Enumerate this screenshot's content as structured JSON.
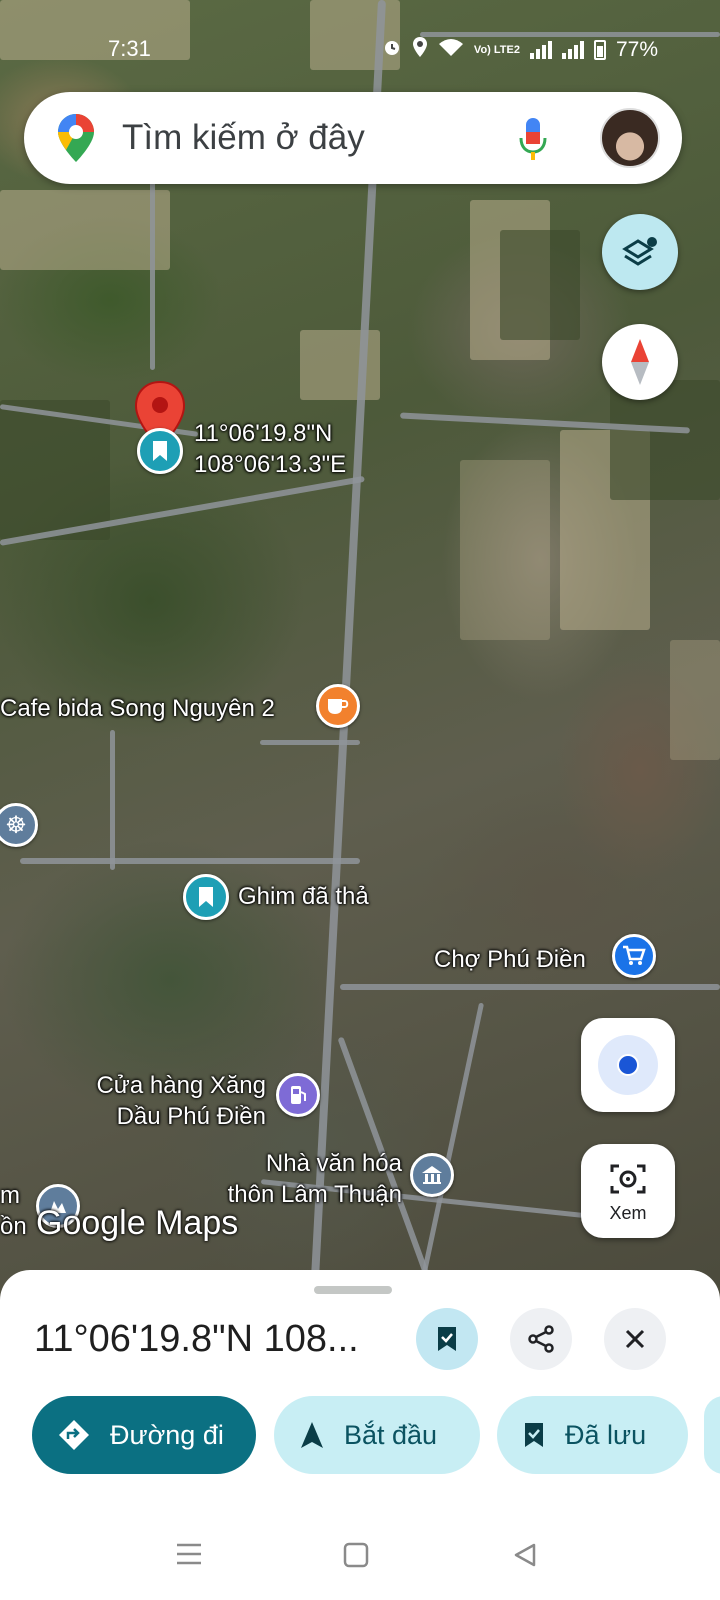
{
  "status_bar": {
    "time": "7:31",
    "volte_label": "Vo) LTE2",
    "battery": "77%"
  },
  "search": {
    "placeholder": "Tìm kiếm ở đây"
  },
  "map": {
    "dropped_pin_coords_line1": "11°06'19.8\"N",
    "dropped_pin_coords_line2": "108°06'13.3\"E",
    "places": {
      "cafe": "Cafe bida Song Nguyên 2",
      "dropped_pin": "Ghim đã thả",
      "market": "Chợ Phú Điền",
      "gas_line1": "Cửa hàng Xăng",
      "gas_line2": "Dầu Phú Điền",
      "hall_line1": "Nhà văn hóa",
      "hall_line2": "thôn Lâm Thuận",
      "partial_left_line1": "m",
      "partial_left_line2": "ồn"
    },
    "logo": "Google Maps"
  },
  "controls": {
    "lens_label": "Xem"
  },
  "sheet": {
    "title": "11°06'19.8\"N 108...",
    "directions_label": "Đường đi",
    "start_label": "Bắt đầu",
    "saved_label": "Đã lưu"
  },
  "colors": {
    "primary_teal": "#0b7082",
    "chip_light": "#c8eef4",
    "pin_red": "#ea4335",
    "location_blue": "#1a56d6"
  }
}
